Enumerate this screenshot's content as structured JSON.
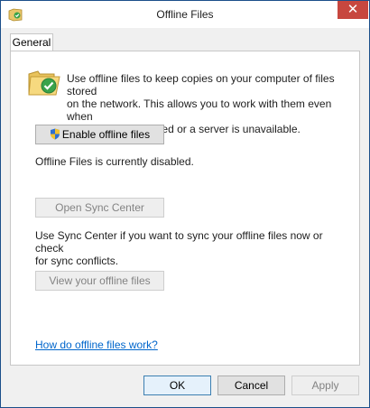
{
  "window": {
    "title": "Offline Files",
    "close_glyph": "✕"
  },
  "tabs": [
    {
      "label": "General",
      "selected": true
    }
  ],
  "general": {
    "intro_line1": "Use offline files to keep copies on your computer of files stored",
    "intro_line2": "on the network.  This allows you to work with them even when",
    "intro_line3": "you are not connected or a server is unavailable.",
    "enable_button_label": "Enable offline files",
    "status_text": "Offline Files is currently disabled.",
    "sync_button_label": "Open Sync Center",
    "sync_desc_line1": "Use Sync Center if you want to sync your offline files now or check",
    "sync_desc_line2": "for sync conflicts.",
    "view_button_label": "View your offline files",
    "help_link": "How do offline files work?"
  },
  "footer": {
    "ok_label": "OK",
    "cancel_label": "Cancel",
    "apply_label": "Apply"
  },
  "icons": {
    "app": "offline-files-icon",
    "intro": "folder-sync-icon",
    "shield": "uac-shield-icon",
    "close": "close-icon"
  },
  "colors": {
    "close_button": "#c7473f",
    "link": "#0066cc",
    "window_border": "#1b4f8a"
  }
}
